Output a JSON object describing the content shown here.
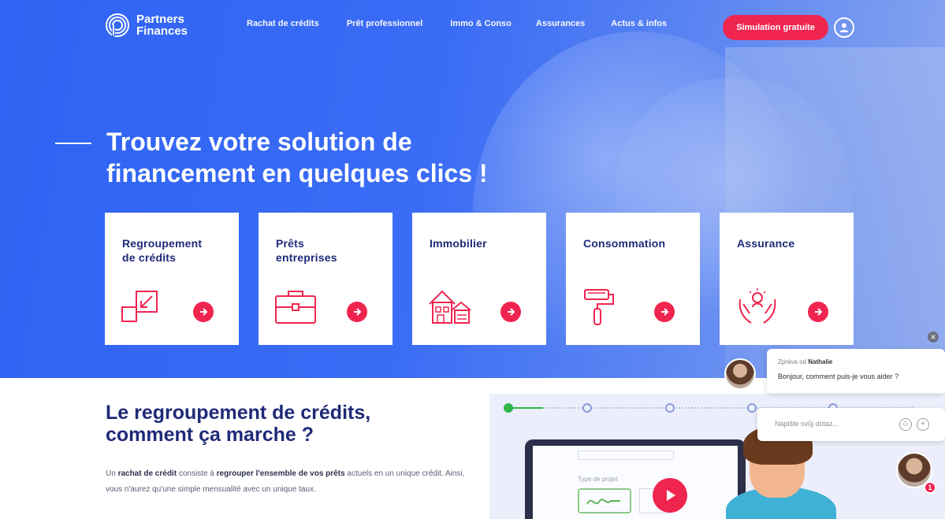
{
  "brand": {
    "line1": "Partners",
    "line2": "Finances",
    "accent": "#f0254f",
    "primary": "#2f63f3",
    "navy": "#1f2a78"
  },
  "nav": {
    "links": [
      "Rachat de crédits",
      "Prêt professionnel",
      "Immo & Conso",
      "Assurances",
      "Actus & infos"
    ],
    "cta": "Simulation gratuite",
    "user_icon": "user-icon"
  },
  "hero": {
    "title_line1": "Trouvez votre solution de",
    "title_line2": "financement en quelques clics !"
  },
  "cards": [
    {
      "line1": "Regroupement",
      "line2": "de crédits",
      "icon": "arrows-merge-icon"
    },
    {
      "line1": "Prêts",
      "line2": "entreprises",
      "icon": "briefcase-icon"
    },
    {
      "line1": "Immobilier",
      "line2": "",
      "icon": "house-icon"
    },
    {
      "line1": "Consommation",
      "line2": "",
      "icon": "paint-roller-icon"
    },
    {
      "line1": "Assurance",
      "line2": "",
      "icon": "hands-protect-icon"
    }
  ],
  "section": {
    "title_line1": "Le regroupement de crédits,",
    "title_line2": "comment ça marche ?",
    "body_1": "Un ",
    "body_b1": "rachat de crédit",
    "body_2": " consiste à ",
    "body_b2": "regrouper l'ensemble de vos prêts",
    "body_3": " actuels en un unique crédit. Ainsi, vous n'aurez qu'une simple mensualité avec un unique taux."
  },
  "video": {
    "caption": "Type de projet",
    "play_icon": "play-icon"
  },
  "chat": {
    "from_prefix": "Zpráva od ",
    "from_name": "Nathalie",
    "message": "Bonjour, comment puis-je vous aider ?",
    "input_placeholder": "Napište svůj dotaz...",
    "badge": "1"
  }
}
